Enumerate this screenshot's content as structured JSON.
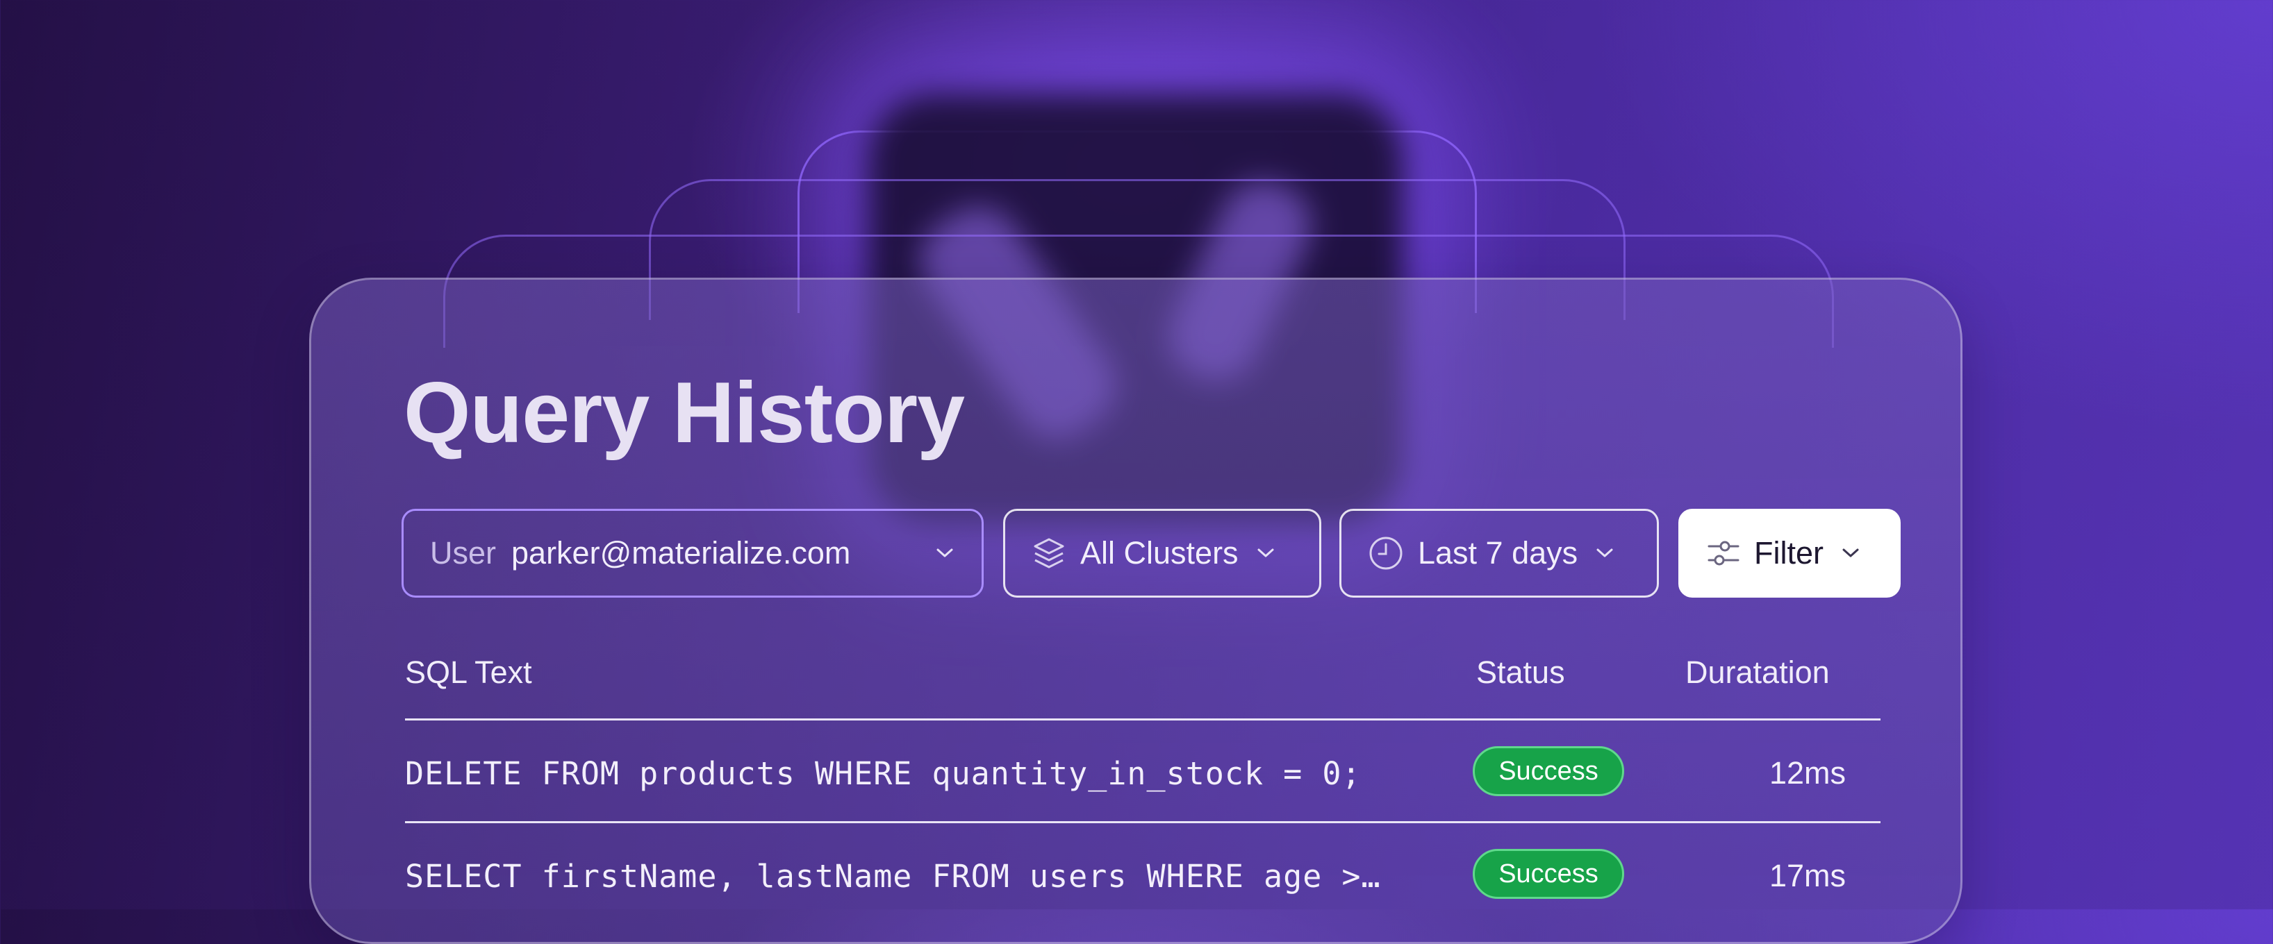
{
  "page": {
    "title": "Query History"
  },
  "filters": {
    "user": {
      "label": "User",
      "value": "parker@materialize.com"
    },
    "clusters": {
      "value": "All Clusters",
      "icon": "layers-icon"
    },
    "time_range": {
      "value": "Last 7 days",
      "icon": "clock-icon"
    },
    "filter": {
      "label": "Filter",
      "icon": "sliders-icon"
    }
  },
  "table": {
    "columns": [
      "SQL Text",
      "Status",
      "Duratation"
    ],
    "rows": [
      {
        "sql": "DELETE FROM products WHERE quantity_in_stock = 0;",
        "status": "Success",
        "duration": "12ms"
      },
      {
        "sql": "SELECT firstName, lastName FROM users WHERE age >…",
        "status": "Success",
        "duration": "17ms"
      }
    ]
  },
  "colors": {
    "accent": "#a98cff",
    "success": "#17a349",
    "background": "#3a1d74"
  }
}
